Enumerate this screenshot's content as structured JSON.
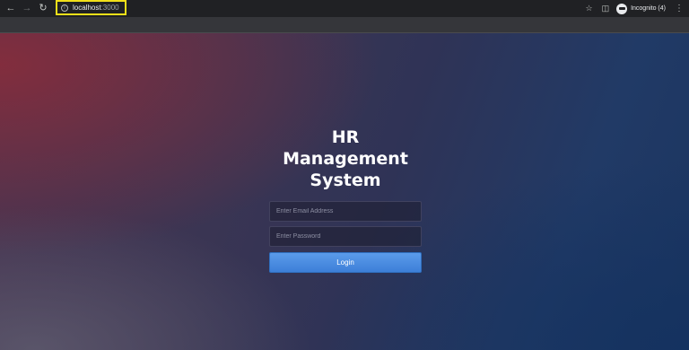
{
  "browser": {
    "url_host": "localhost",
    "url_port": ":3000",
    "incognito_label": "Incognito (4)",
    "highlight_color": "#f2e019",
    "icons": {
      "back": "arrow-left-icon",
      "forward": "arrow-right-icon",
      "reload": "reload-icon",
      "site_info": "info-icon",
      "bookmark": "star-icon",
      "side_panel": "side-panel-icon",
      "incognito": "incognito-icon",
      "menu": "kebab-menu-icon"
    }
  },
  "login": {
    "title": "HR Management System",
    "email_placeholder": "Enter Email Address",
    "email_value": "",
    "password_placeholder": "Enter Password",
    "password_value": "",
    "button_label": "Login",
    "button_color": "#4a8be0"
  },
  "page_colors": {
    "top_left": "#8c2c3a",
    "center": "#2f3356",
    "bottom_right": "#143260"
  }
}
